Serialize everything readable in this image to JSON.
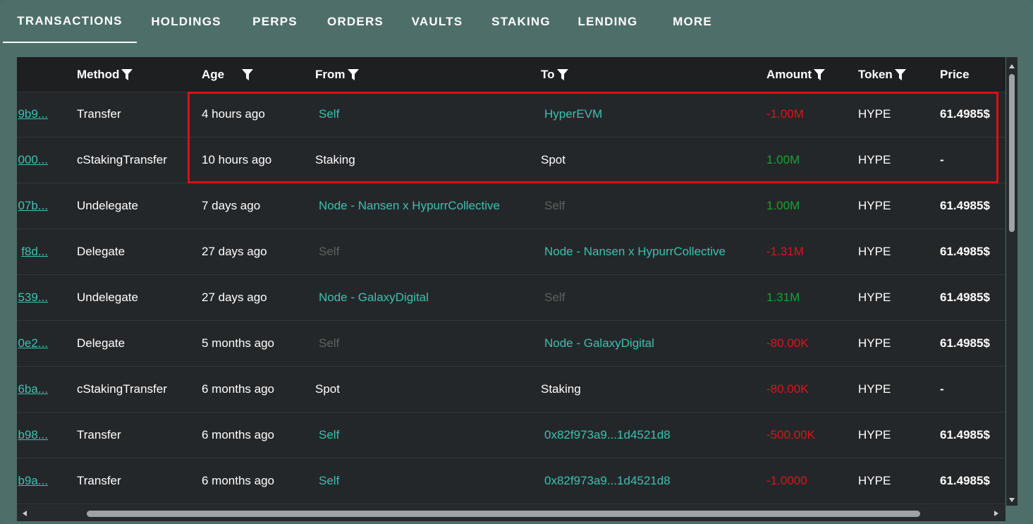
{
  "tabs": [
    {
      "label": "TRANSACTIONS",
      "active": true
    },
    {
      "label": "HOLDINGS"
    },
    {
      "label": "PERPS"
    },
    {
      "label": "ORDERS"
    },
    {
      "label": "VAULTS"
    },
    {
      "label": "STAKING"
    },
    {
      "label": "LENDING"
    },
    {
      "label": "MORE"
    }
  ],
  "table": {
    "headers": {
      "method": "Method",
      "age": "Age",
      "from": "From",
      "to": "To",
      "amount": "Amount",
      "token": "Token",
      "price": "Price"
    },
    "rows": [
      {
        "hash": "9b9...",
        "method": "Transfer",
        "age": "4 hours ago",
        "from": "Self",
        "to": "HyperEVM",
        "amount": "-1.00M",
        "token": "HYPE",
        "price": "61.4985$"
      },
      {
        "hash": "000...",
        "method": "cStakingTransfer",
        "age": "10 hours ago",
        "from": "Staking",
        "to": "Spot",
        "amount": "1.00M",
        "token": "HYPE",
        "price": "-"
      },
      {
        "hash": "07b...",
        "method": "Undelegate",
        "age": "7 days ago",
        "from": "Node - Nansen x HypurrCollective",
        "to": "Self",
        "amount": "1.00M",
        "token": "HYPE",
        "price": "61.4985$"
      },
      {
        "hash": "f8d...",
        "method": "Delegate",
        "age": "27 days ago",
        "from": "Self",
        "to": "Node - Nansen x HypurrCollective",
        "amount": "-1.31M",
        "token": "HYPE",
        "price": "61.4985$"
      },
      {
        "hash": "539...",
        "method": "Undelegate",
        "age": "27 days ago",
        "from": "Node - GalaxyDigital",
        "to": "Self",
        "amount": "1.31M",
        "token": "HYPE",
        "price": "61.4985$"
      },
      {
        "hash": "0e2...",
        "method": "Delegate",
        "age": "5 months ago",
        "from": "Self",
        "to": "Node - GalaxyDigital",
        "amount": "-80.00K",
        "token": "HYPE",
        "price": "61.4985$"
      },
      {
        "hash": "6ba...",
        "method": "cStakingTransfer",
        "age": "6 months ago",
        "from": "Spot",
        "to": "Staking",
        "amount": "-80.00K",
        "token": "HYPE",
        "price": "-"
      },
      {
        "hash": "b98...",
        "method": "Transfer",
        "age": "6 months ago",
        "from": "Self",
        "to": "0x82f973a9...1d4521d8",
        "amount": "-500.00K",
        "token": "HYPE",
        "price": "61.4985$"
      },
      {
        "hash": "b9a...",
        "method": "Transfer",
        "age": "6 months ago",
        "from": "Self",
        "to": "0x82f973a9...1d4521d8",
        "amount": "-1.0000",
        "token": "HYPE",
        "price": "61.4985$"
      }
    ]
  },
  "colors": {
    "accent_teal": "#3cc1ae",
    "negative": "#d9161a",
    "positive": "#16a32f",
    "dim": "#5b6360",
    "highlight_box": "#e00d14"
  },
  "icons": {
    "filter": "funnel-icon"
  }
}
